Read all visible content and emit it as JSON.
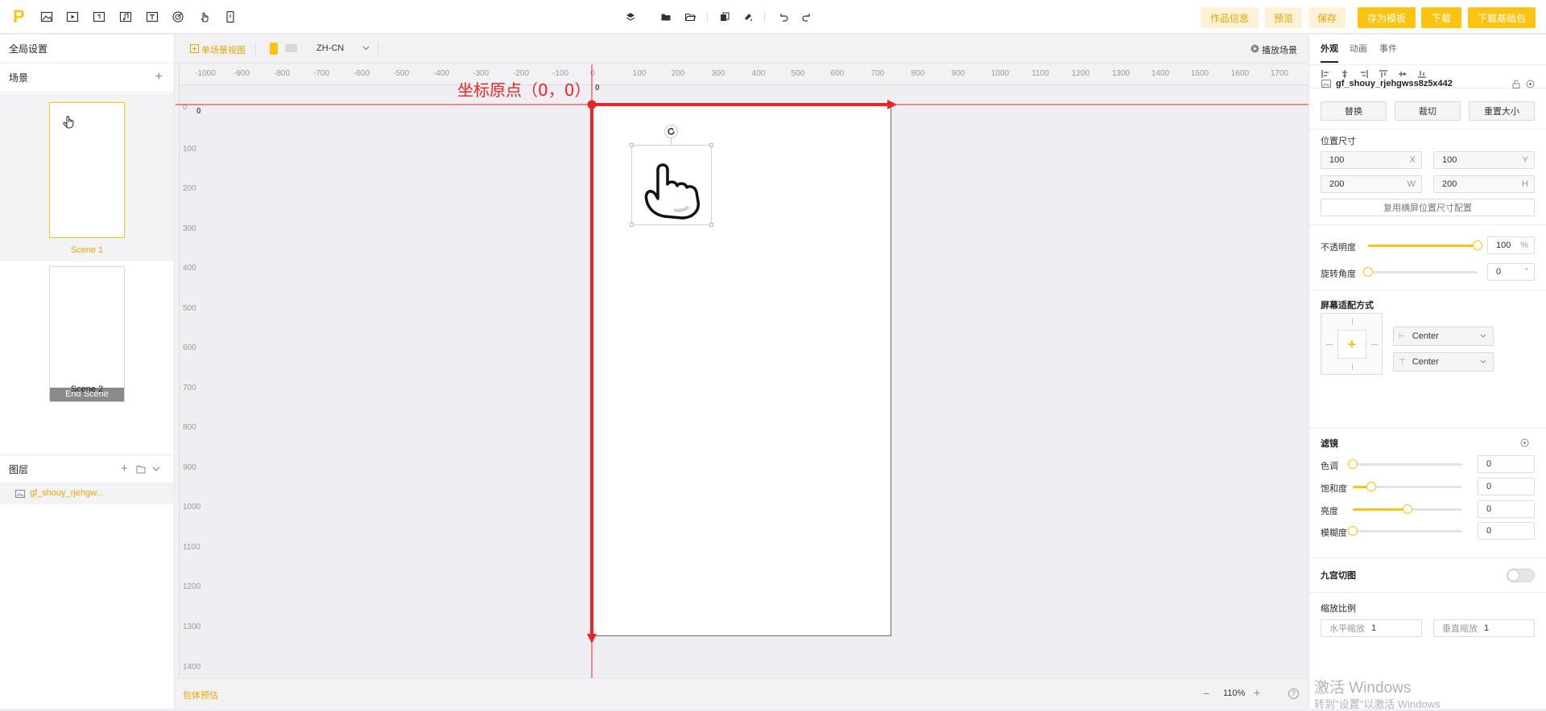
{
  "colors": {
    "accent": "#fcc310",
    "accent_text": "#e6a700",
    "annotation": "#ee2222"
  },
  "topbar": {
    "logo": "P",
    "toolbar_icons": [
      "image-icon",
      "video-icon",
      "file-icon",
      "music-icon",
      "text-icon",
      "target-icon",
      "hand-icon",
      "phone-icon"
    ],
    "center_icons": [
      "layers-icon",
      "folder-icon",
      "folder-open-icon",
      "copy-icon",
      "paint-icon",
      "undo-icon",
      "redo-icon"
    ],
    "buttons": {
      "info": "作品信息",
      "preview": "预览",
      "save": "保存",
      "save_template": "存为模板",
      "download": "下载",
      "download_base": "下载基础包"
    }
  },
  "left": {
    "global_settings": "全局设置",
    "scenes_label": "场景",
    "scenes": [
      {
        "label": "Scene 1",
        "badge": ""
      },
      {
        "label": "Scene 2",
        "badge": "End Scene"
      }
    ],
    "layers_label": "图层",
    "layer_item": "gf_shouy_rjehgw..."
  },
  "canvas": {
    "view_label": "单场景视图",
    "lang": "ZH-CN",
    "play_scene": "播放场景",
    "annotation": "坐标原点（0，0）",
    "ruler_h": [
      "-1000",
      "-900",
      "-800",
      "-700",
      "-600",
      "-500",
      "-400",
      "-300",
      "-200",
      "-100",
      "0",
      "100",
      "200",
      "300",
      "400",
      "500",
      "600",
      "700",
      "800",
      "900",
      "1000",
      "1100",
      "1200",
      "1300",
      "1400",
      "1500",
      "1600",
      "1700"
    ],
    "ruler_v": [
      "0",
      "100",
      "200",
      "300",
      "400",
      "500",
      "600",
      "700",
      "800",
      "900",
      "1000",
      "1100",
      "1200",
      "1300",
      "1400"
    ],
    "origin_x": "0",
    "origin_y": "0"
  },
  "bottom": {
    "resource_estimate": "包体预估",
    "zoom": "110%"
  },
  "right": {
    "tabs": [
      "外观",
      "动画",
      "事件"
    ],
    "layer_name": "gf_shouy_rjehgwss8z5x442",
    "buttons": {
      "replace": "替换",
      "crop": "裁切",
      "reset_size": "重置大小"
    },
    "position_size": {
      "title": "位置尺寸",
      "x": "100",
      "y": "100",
      "w": "200",
      "h": "200",
      "x_suffix": "X",
      "y_suffix": "Y",
      "w_suffix": "W",
      "h_suffix": "H",
      "reuse": "复用横屏位置尺寸配置"
    },
    "opacity": {
      "label": "不透明度",
      "value": "100",
      "unit": "%",
      "fraction": 1.0
    },
    "rotation": {
      "label": "旋转角度",
      "value": "0",
      "unit": "°",
      "fraction": 0.0
    },
    "screen_fit": {
      "title": "屏幕适配方式",
      "h_option": "Center",
      "v_option": "Center"
    },
    "filters": {
      "title": "滤镜",
      "items": [
        {
          "label": "色调",
          "value": "0",
          "fraction": 0.0
        },
        {
          "label": "饱和度",
          "value": "0",
          "fraction": 0.17
        },
        {
          "label": "亮度",
          "value": "0",
          "fraction": 0.5
        },
        {
          "label": "模糊度",
          "value": "0",
          "fraction": 0.0
        }
      ]
    },
    "nine_slice": {
      "title": "九宫切图",
      "enabled": false
    },
    "scale": {
      "title": "缩放比例",
      "h_label": "水平缩放",
      "h_value": "1",
      "v_label": "垂直缩放",
      "v_value": "1"
    }
  },
  "watermark": {
    "line1": "激活 Windows",
    "line2": "转到\"设置\"以激活 Windows"
  }
}
